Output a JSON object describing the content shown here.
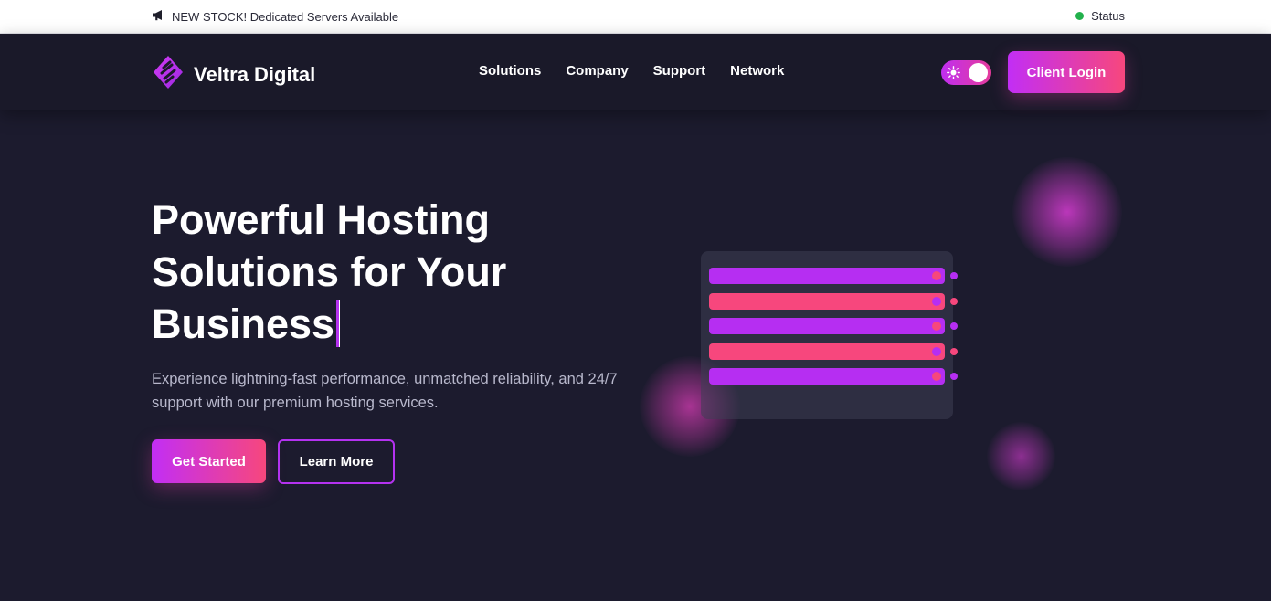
{
  "announcement": {
    "text": "NEW STOCK! Dedicated Servers Available",
    "icon": "megaphone-icon"
  },
  "status": {
    "label": "Status",
    "indicator_color": "#22b14c"
  },
  "brand": {
    "name": "Veltra Digital",
    "logo_icon": "veltra-logo-icon"
  },
  "nav": {
    "links": [
      "Solutions",
      "Company",
      "Support",
      "Network"
    ]
  },
  "theme_toggle": {
    "icon": "sun-icon",
    "state": "on"
  },
  "client_login": {
    "label": "Client Login"
  },
  "hero": {
    "title": "Powerful Hosting Solutions for Your Business",
    "subtitle": "Experience lightning-fast performance, unmatched reliability, and 24/7 support with our premium hosting services.",
    "primary_button": "Get Started",
    "secondary_button": "Learn More"
  },
  "illustration": {
    "server_rows": [
      {
        "bar_color": "#b62ef2",
        "led_color": "#f7477d",
        "dot_color": "#b62ef2"
      },
      {
        "bar_color": "#f7477d",
        "led_color": "#b62ef2",
        "dot_color": "#f7477d"
      },
      {
        "bar_color": "#b62ef2",
        "led_color": "#f7477d",
        "dot_color": "#b62ef2"
      },
      {
        "bar_color": "#f7477d",
        "led_color": "#b62ef2",
        "dot_color": "#f7477d"
      },
      {
        "bar_color": "#b62ef2",
        "led_color": "#f7477d",
        "dot_color": "#b62ef2"
      }
    ]
  },
  "colors": {
    "background": "#1c1b2e",
    "navbar": "#1a1929",
    "accent_start": "#c22ef5",
    "accent_end": "#f7477d",
    "outline": "#b432f0"
  }
}
